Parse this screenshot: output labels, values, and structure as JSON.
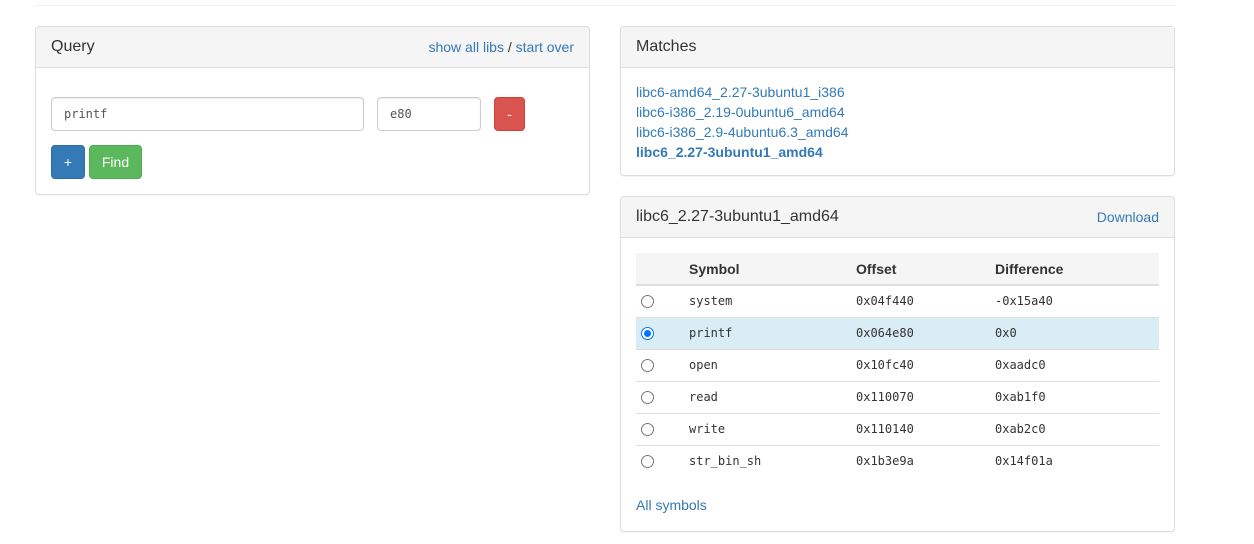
{
  "query": {
    "title": "Query",
    "show_all_libs": "show all libs",
    "separator": "/",
    "start_over": "start over",
    "symbol_value": "printf",
    "address_value": "e80",
    "remove_label": "-",
    "add_label": "+",
    "find_label": "Find"
  },
  "matches": {
    "title": "Matches",
    "items": [
      "libc6-amd64_2.27-3ubuntu1_i386",
      "libc6-i386_2.19-0ubuntu6_amd64",
      "libc6-i386_2.9-4ubuntu6.3_amd64",
      "libc6_2.27-3ubuntu1_amd64"
    ]
  },
  "lib": {
    "title": "libc6_2.27-3ubuntu1_amd64",
    "download": "Download",
    "headers": {
      "symbol": "Symbol",
      "offset": "Offset",
      "difference": "Difference"
    },
    "rows": [
      {
        "symbol": "system",
        "offset": "0x04f440",
        "difference": "-0x15a40"
      },
      {
        "symbol": "printf",
        "offset": "0x064e80",
        "difference": "0x0"
      },
      {
        "symbol": "open",
        "offset": "0x10fc40",
        "difference": "0xaadc0"
      },
      {
        "symbol": "read",
        "offset": "0x110070",
        "difference": "0xab1f0"
      },
      {
        "symbol": "write",
        "offset": "0x110140",
        "difference": "0xab2c0"
      },
      {
        "symbol": "str_bin_sh",
        "offset": "0x1b3e9a",
        "difference": "0x14f01a"
      }
    ],
    "all_symbols": "All symbols"
  },
  "colors": {
    "link": "#337ab7",
    "danger": "#d9534f",
    "primary": "#337ab7",
    "success": "#5cb85c",
    "selected_row": "#d9edf7"
  }
}
